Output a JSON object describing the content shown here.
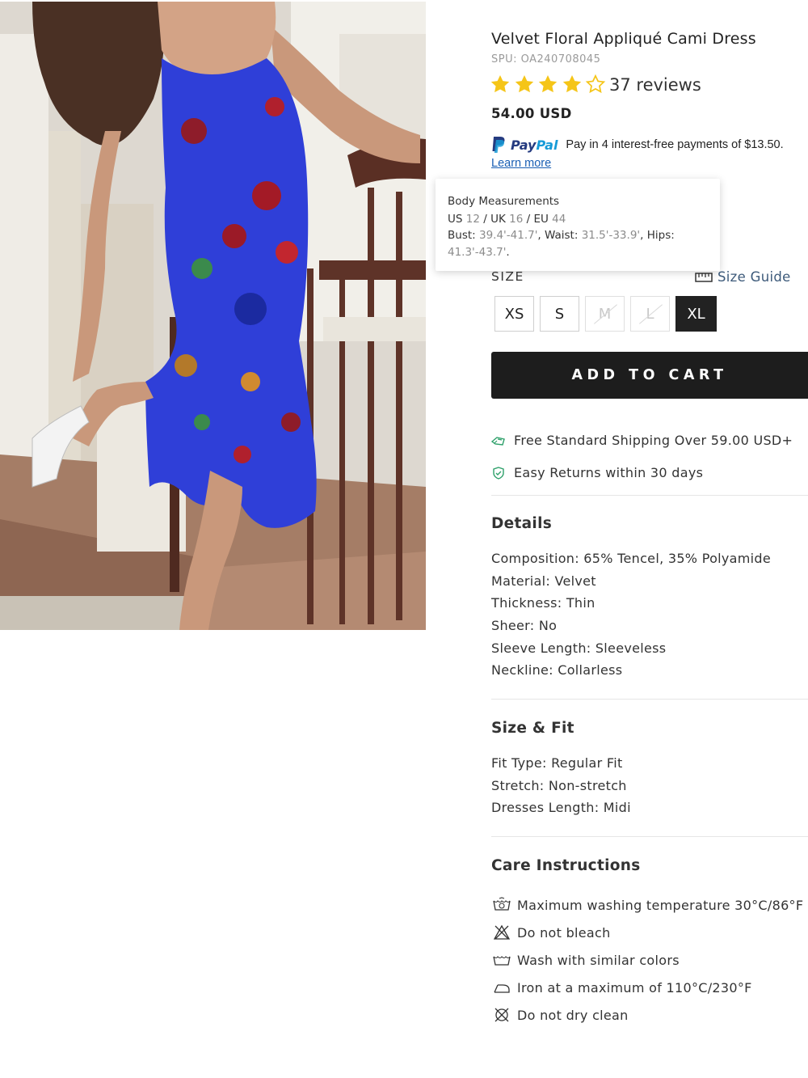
{
  "product": {
    "title": "Velvet Floral Appliqué Cami Dress",
    "spu": "SPU: OA240708045",
    "rating": 4.5,
    "reviews": "37 reviews",
    "price": "54.00 USD"
  },
  "paypal": {
    "brand_pay": "Pay",
    "brand_pal": "Pal",
    "message": "Pay in 4 interest-free payments of $13.50.",
    "learn_more": "Learn more"
  },
  "tooltip": {
    "title": "Body Measurements",
    "us_label": "US",
    "us": "12",
    "uk_label": "UK",
    "uk": "16",
    "eu_label": "EU",
    "eu": "44",
    "bust_label": "Bust:",
    "bust": "39.4'-41.7'",
    "waist_label": "Waist:",
    "waist": "31.5'-33.9'",
    "hips_label": "Hips:",
    "hips": "41.3'-43.7'"
  },
  "size": {
    "label": "SIZE",
    "guide": "Size Guide",
    "options": [
      {
        "label": "XS",
        "state": "available"
      },
      {
        "label": "S",
        "state": "available"
      },
      {
        "label": "M",
        "state": "disabled"
      },
      {
        "label": "L",
        "state": "disabled"
      },
      {
        "label": "XL",
        "state": "selected"
      }
    ]
  },
  "actions": {
    "add_to_cart": "ADD TO CART"
  },
  "perks": {
    "shipping": "Free Standard Shipping Over 59.00 USD+",
    "returns": "Easy Returns within 30 days"
  },
  "details": {
    "title": "Details",
    "items": [
      "Composition: 65% Tencel, 35% Polyamide",
      "Material: Velvet",
      "Thickness: Thin",
      "Sheer: No",
      "Sleeve Length: Sleeveless",
      "Neckline: Collarless"
    ]
  },
  "size_fit": {
    "title": "Size & Fit",
    "items": [
      "Fit Type: Regular Fit",
      "Stretch: Non-stretch",
      "Dresses Length: Midi"
    ]
  },
  "care": {
    "title": "Care Instructions",
    "items": [
      {
        "icon": "wash-30-icon",
        "text": "Maximum washing temperature 30°C/86°F"
      },
      {
        "icon": "no-bleach-icon",
        "text": "Do not bleach"
      },
      {
        "icon": "wash-basin-icon",
        "text": "Wash with similar colors"
      },
      {
        "icon": "iron-icon",
        "text": "Iron at a maximum of 110°C/230°F"
      },
      {
        "icon": "no-dry-clean-icon",
        "text": "Do not dry clean"
      }
    ]
  },
  "colors": {
    "accent_dark": "#1d1d1d",
    "star": "#f5c518",
    "perk_green": "#2ea06a",
    "link": "#1a5fb4"
  }
}
